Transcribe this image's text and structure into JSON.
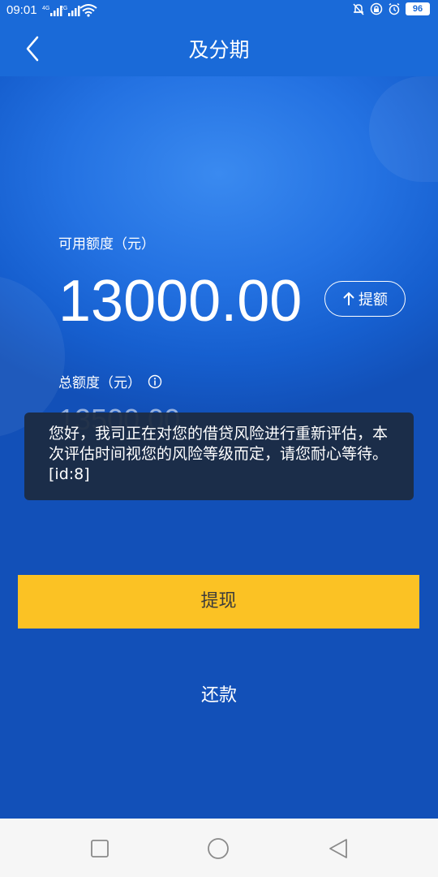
{
  "status_bar": {
    "time": "09:01",
    "signal_1_label": "4G",
    "signal_2_label": "2G",
    "battery": "96"
  },
  "header": {
    "title": "及分期"
  },
  "credit": {
    "available_label": "可用额度（元）",
    "available_amount": "13000.00",
    "raise_label": "提额",
    "total_label": "总额度（元）",
    "total_amount": "13500.00"
  },
  "toast": {
    "message": "您好，我司正在对您的借贷风险进行重新评估，本次评估时间视您的风险等级而定，请您耐心等待。[id:8]"
  },
  "actions": {
    "withdraw_label": "提现",
    "repay_label": "还款"
  },
  "colors": {
    "header_bg": "#1a6ad8",
    "main_bg": "#2472e2",
    "withdraw_bg": "#fbc224",
    "toast_bg": "#1c2a42",
    "navbar_bg": "#f6f6f6"
  },
  "icons": {
    "back": "chevron-left-icon",
    "raise": "arrow-up-icon",
    "info": "info-circle-icon",
    "nav_recents": "square-icon",
    "nav_home": "circle-icon",
    "nav_back": "triangle-back-icon"
  }
}
